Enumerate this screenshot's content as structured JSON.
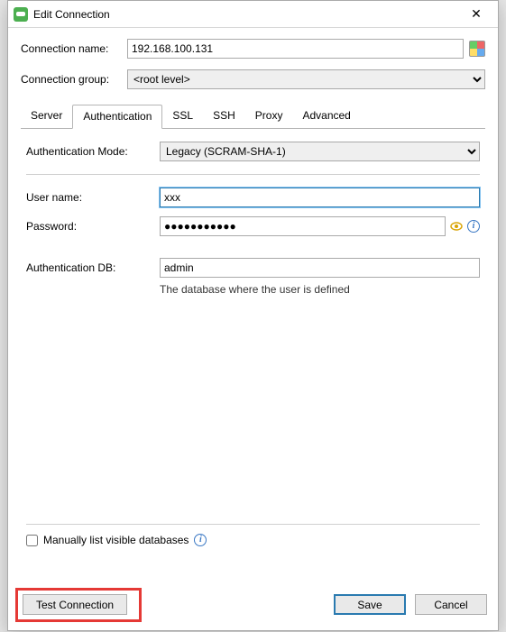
{
  "window": {
    "title": "Edit Connection"
  },
  "conn_name": {
    "label": "Connection name:",
    "value": "192.168.100.131"
  },
  "conn_group": {
    "label": "Connection group:",
    "value": "<root level>"
  },
  "tabs": {
    "server": "Server",
    "authentication": "Authentication",
    "ssl": "SSL",
    "ssh": "SSH",
    "proxy": "Proxy",
    "advanced": "Advanced"
  },
  "auth": {
    "mode_label": "Authentication Mode:",
    "mode_value": "Legacy (SCRAM-SHA-1)",
    "user_label": "User name:",
    "user_value": "xxx",
    "pw_label": "Password:",
    "pw_mask": "●●●●●●●●●●●",
    "db_label": "Authentication DB:",
    "db_value": "admin",
    "db_help": "The database where the user is defined",
    "list_db_label": "Manually list visible databases"
  },
  "buttons": {
    "test": "Test Connection",
    "save": "Save",
    "cancel": "Cancel"
  }
}
